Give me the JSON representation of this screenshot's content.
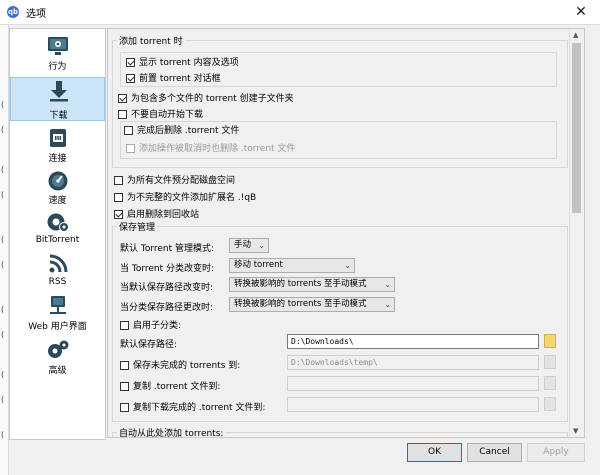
{
  "window": {
    "title": "选项",
    "app_icon": "qb",
    "close_glyph": "✕"
  },
  "left_strip": [
    "(",
    "(",
    "(",
    "(",
    "(",
    "(",
    "(",
    "(",
    "(",
    "(",
    "("
  ],
  "sidebar": {
    "items": [
      {
        "label": "行为",
        "icon": "monitor-icon"
      },
      {
        "label": "下载",
        "icon": "download-icon",
        "selected": true
      },
      {
        "label": "连接",
        "icon": "network-icon"
      },
      {
        "label": "速度",
        "icon": "speedometer-icon"
      },
      {
        "label": "BitTorrent",
        "icon": "bittorrent-gear-icon"
      },
      {
        "label": "RSS",
        "icon": "rss-icon"
      },
      {
        "label": "Web 用户界面",
        "icon": "web-ui-icon"
      },
      {
        "label": "高级",
        "icon": "gears-icon"
      }
    ]
  },
  "add_torrent": {
    "title": "添加 torrent 时",
    "show_content": {
      "label": "显示 torrent 内容及选项",
      "checked": true
    },
    "bring_front": {
      "label": "前置 torrent 对话框",
      "checked": true
    },
    "create_subfolder": {
      "label": "为包含多个文件的 torrent 创建子文件夹",
      "checked": true
    },
    "no_auto_start": {
      "label": "不要自动开始下载",
      "checked": false
    },
    "delete_after": {
      "label": "完成后删除 .torrent 文件",
      "checked": false
    },
    "delete_on_cancel": {
      "label": "添加操作被取消时也删除 .torrent 文件",
      "checked": false,
      "disabled": true
    }
  },
  "preallocate": {
    "label": "为所有文件预分配磁盘空间",
    "checked": false
  },
  "append_ext": {
    "label": "为不完整的文件添加扩展名 .!qB",
    "checked": false
  },
  "recycle": {
    "label": "启用删除到回收站",
    "checked": true
  },
  "saving": {
    "title": "保存管理",
    "default_mode_label": "默认 Torrent 管理模式:",
    "default_mode_value": "手动",
    "category_changed_label": "当 Torrent 分类改变时:",
    "category_changed_value": "移动 torrent",
    "default_path_changed_label": "当默认保存路径改变时:",
    "default_path_changed_value": "转换被影响的 torrents 至手动模式",
    "category_path_changed_label": "当分类保存路径更改时:",
    "category_path_changed_value": "转换被影响的 torrents 至手动模式",
    "use_subcategories": {
      "label": "启用子分类:",
      "checked": false
    },
    "default_save_label": "默认保存路径:",
    "default_save_value": "D:\\Downloads\\",
    "keep_incomplete": {
      "label": "保存未完成的 torrents 到:",
      "checked": false
    },
    "incomplete_value": "D:\\Downloads\\temp\\",
    "copy_torrent": {
      "label": "复制 .torrent 文件到:",
      "checked": false
    },
    "copy_finished": {
      "label": "复制下载完成的 .torrent 文件到:",
      "checked": false
    }
  },
  "auto_add": {
    "title": "自动从此处添加 torrents:"
  },
  "buttons": {
    "ok": "OK",
    "cancel": "Cancel",
    "apply": "Apply"
  },
  "scroll": {
    "up": "▲",
    "down": "▼"
  }
}
